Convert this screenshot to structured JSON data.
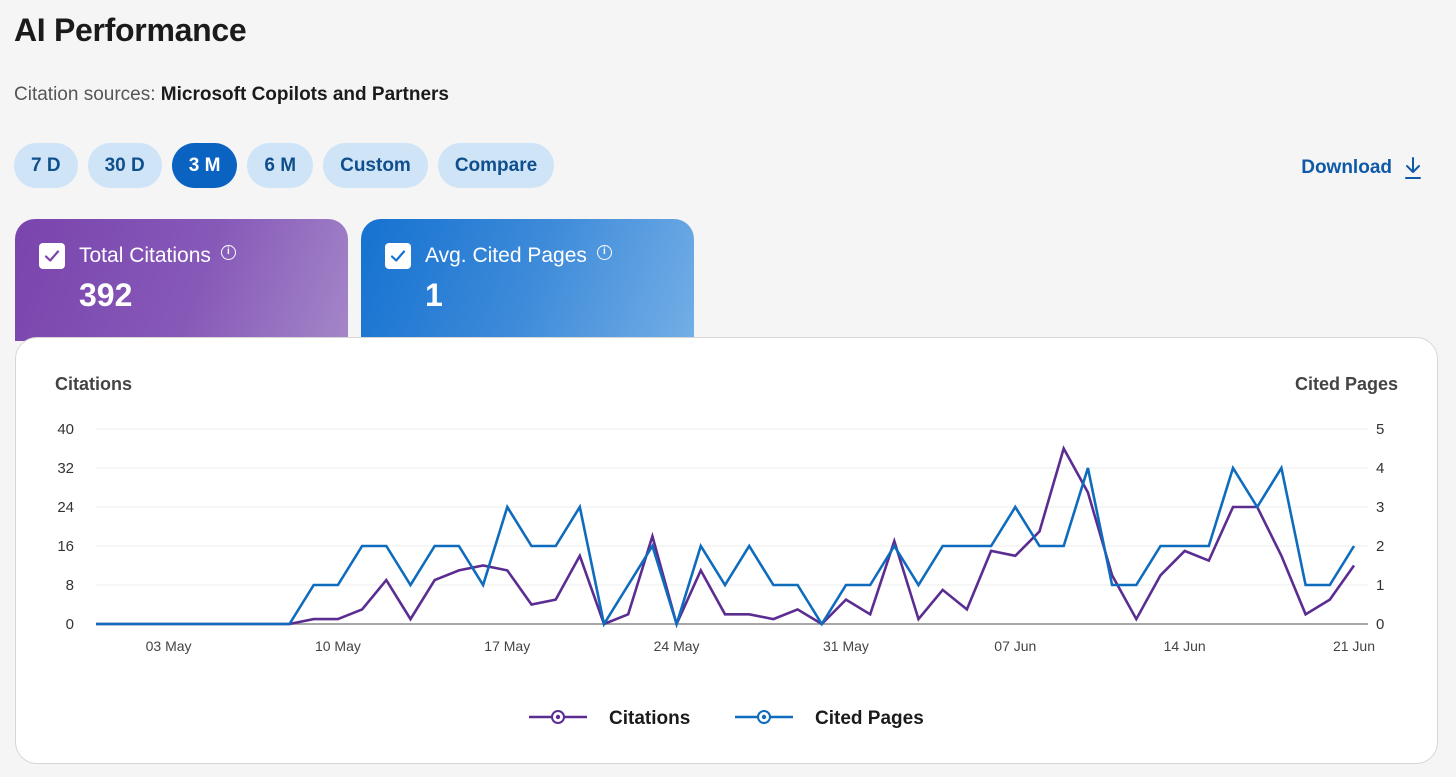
{
  "header": {
    "title": "AI Performance",
    "citation_label": "Citation sources:",
    "citation_value": "Microsoft Copilots and Partners"
  },
  "ranges": [
    {
      "label": "7 D",
      "active": false
    },
    {
      "label": "30 D",
      "active": false
    },
    {
      "label": "3 M",
      "active": true
    },
    {
      "label": "6 M",
      "active": false
    },
    {
      "label": "Custom",
      "active": false
    },
    {
      "label": "Compare",
      "active": false
    }
  ],
  "download": {
    "label": "Download",
    "icon": "download-icon"
  },
  "metrics": {
    "citations": {
      "label": "Total Citations",
      "value": "392",
      "color": "#7a44ad"
    },
    "pages": {
      "label": "Avg. Cited Pages",
      "value": "1",
      "color": "#1572d0"
    }
  },
  "chart_data": {
    "type": "line",
    "ylabel": "Citations",
    "y2label": "Cited Pages",
    "ylim": [
      0,
      40
    ],
    "y2lim": [
      0,
      5
    ],
    "yticks": [
      0,
      8,
      16,
      24,
      32,
      40
    ],
    "y2ticks": [
      0,
      1,
      2,
      3,
      4,
      5
    ],
    "xtick_labels": [
      "03 May",
      "10 May",
      "17 May",
      "24 May",
      "31 May",
      "07 Jun",
      "14 Jun",
      "21 Jun"
    ],
    "xtick_indices": [
      3,
      10,
      17,
      24,
      31,
      38,
      45,
      52
    ],
    "grid": "horizontal",
    "legend": "bottom-center",
    "series": [
      {
        "name": "Citations",
        "axis": "left",
        "color": "#5b2d91",
        "values": [
          0,
          0,
          0,
          0,
          0,
          0,
          0,
          0,
          0,
          1,
          1,
          3,
          9,
          1,
          9,
          11,
          12,
          11,
          4,
          5,
          14,
          0,
          2,
          18,
          0,
          11,
          2,
          2,
          1,
          3,
          0,
          5,
          2,
          17,
          1,
          7,
          3,
          15,
          14,
          19,
          36,
          27,
          10,
          1,
          10,
          15,
          13,
          24,
          24,
          14,
          2,
          5,
          12
        ]
      },
      {
        "name": "Cited Pages",
        "axis": "right",
        "color": "#0f6cbd",
        "values": [
          0,
          0,
          0,
          0,
          0,
          0,
          0,
          0,
          0,
          1,
          1,
          2,
          2,
          1,
          2,
          2,
          1,
          3,
          2,
          2,
          3,
          0,
          1,
          2,
          0,
          2,
          1,
          2,
          1,
          1,
          0,
          1,
          1,
          2,
          1,
          2,
          2,
          2,
          3,
          2,
          2,
          4,
          1,
          1,
          2,
          2,
          2,
          4,
          3,
          4,
          1,
          1,
          2
        ]
      }
    ]
  }
}
